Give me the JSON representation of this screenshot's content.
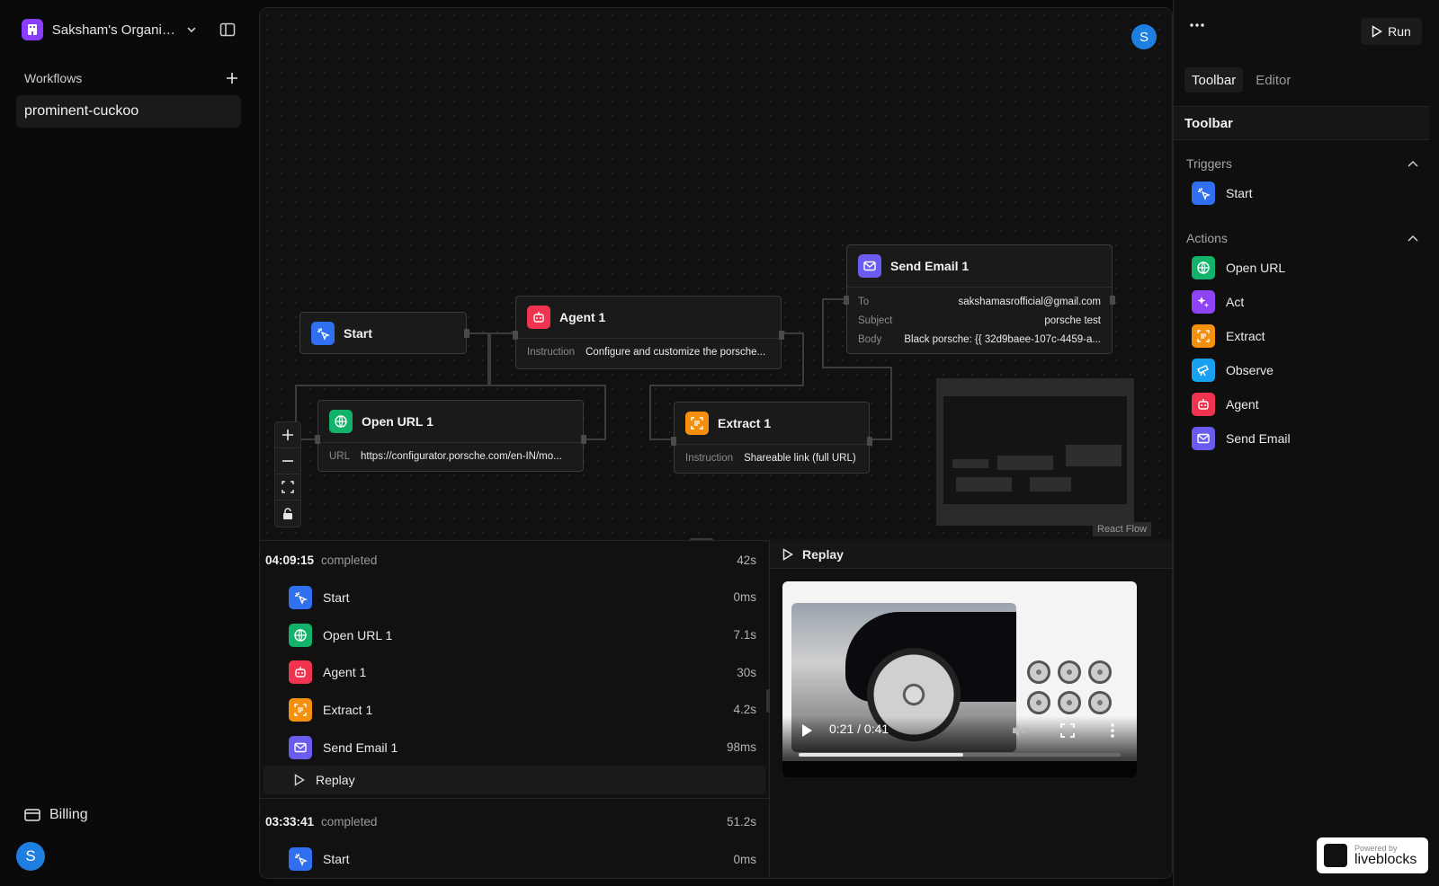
{
  "sidebar": {
    "org_name": "Saksham's Organiz...",
    "workflows_label": "Workflows",
    "workflow_item": "prominent-cuckoo",
    "billing_label": "Billing",
    "avatar_initial": "S"
  },
  "canvas": {
    "avatar_initial": "S",
    "attribution": "React Flow",
    "nodes": {
      "start": {
        "title": "Start"
      },
      "agent": {
        "title": "Agent 1",
        "instruction_label": "Instruction",
        "instruction_value": "Configure and customize the porsche..."
      },
      "email": {
        "title": "Send Email 1",
        "to_label": "To",
        "to_value": "sakshamasrofficial@gmail.com",
        "subject_label": "Subject",
        "subject_value": "porsche test",
        "body_label": "Body",
        "body_value": "Black porsche: {{ 32d9baee-107c-4459-a..."
      },
      "open_url": {
        "title": "Open URL 1",
        "url_label": "URL",
        "url_value": "https://configurator.porsche.com/en-IN/mo..."
      },
      "extract": {
        "title": "Extract 1",
        "instruction_label": "Instruction",
        "instruction_value": "Shareable link (full URL)"
      }
    }
  },
  "runs": [
    {
      "time": "04:09:15",
      "status": "completed",
      "duration": "42s",
      "steps": [
        {
          "label": "Start",
          "duration": "0ms",
          "icon": "start-icon"
        },
        {
          "label": "Open URL 1",
          "duration": "7.1s",
          "icon": "globe-icon"
        },
        {
          "label": "Agent 1",
          "duration": "30s",
          "icon": "robot-icon"
        },
        {
          "label": "Extract 1",
          "duration": "4.2s",
          "icon": "extract-icon"
        },
        {
          "label": "Send Email 1",
          "duration": "98ms",
          "icon": "mail-icon"
        }
      ],
      "replay_label": "Replay"
    },
    {
      "time": "03:33:41",
      "status": "completed",
      "duration": "51.2s",
      "steps": [
        {
          "label": "Start",
          "duration": "0ms",
          "icon": "start-icon"
        }
      ]
    }
  ],
  "replay": {
    "title": "Replay",
    "time": "0:21 / 0:41",
    "progress": 0.51
  },
  "right": {
    "run_label": "Run",
    "tabs": [
      "Toolbar",
      "Editor"
    ],
    "panel_title": "Toolbar",
    "triggers_label": "Triggers",
    "triggers": [
      {
        "label": "Start"
      }
    ],
    "actions_label": "Actions",
    "actions": [
      {
        "label": "Open URL"
      },
      {
        "label": "Act"
      },
      {
        "label": "Extract"
      },
      {
        "label": "Observe"
      },
      {
        "label": "Agent"
      },
      {
        "label": "Send Email"
      }
    ]
  },
  "branding": {
    "powered": "Powered by",
    "name": "liveblocks"
  },
  "colors": {
    "start": "#2f6ff0",
    "openurl": "#13b26b",
    "act": "#8e44f5",
    "extract": "#f5900f",
    "observe": "#1aa0f0",
    "agent": "#f0344f",
    "email": "#6b5cf0",
    "accent_avatar": "#1f7fe0"
  }
}
